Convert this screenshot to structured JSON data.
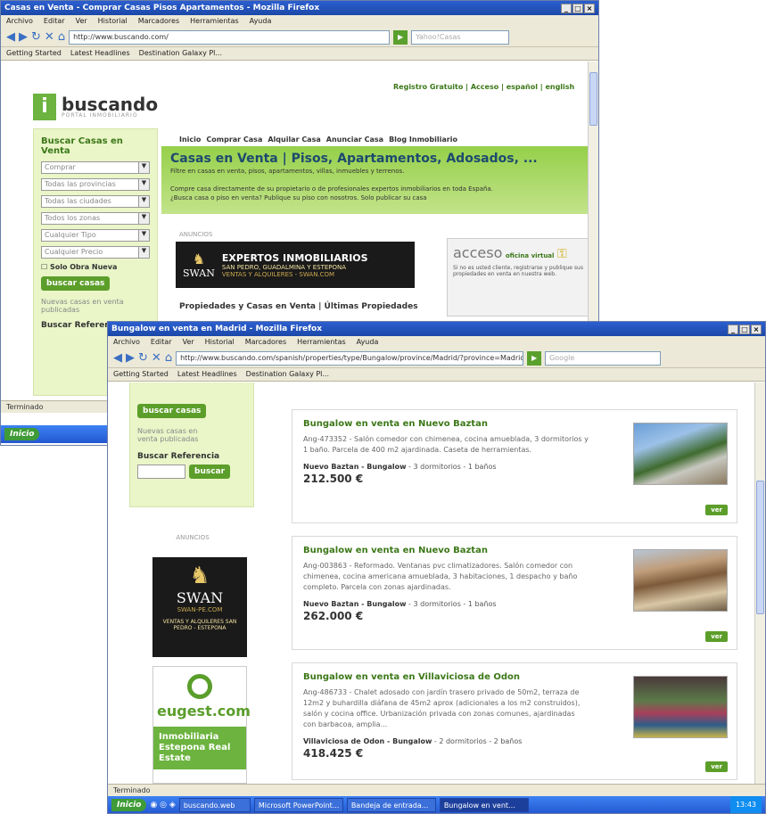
{
  "back_window": {
    "title": "Casas en Venta - Comprar Casas Pisos Apartamentos - Mozilla Firefox",
    "menu": [
      "Archivo",
      "Editar",
      "Ver",
      "Historial",
      "Marcadores",
      "Herramientas",
      "Ayuda"
    ],
    "url": "http://www.buscando.com/",
    "search_placeholder": "Yahoo!Casas",
    "bookmarks": [
      "Getting Started",
      "Latest Headlines",
      "Destination Galaxy Pl..."
    ],
    "site": {
      "logo_name": "buscando",
      "logo_tagline": "PORTAL INMOBILIARIO",
      "top_links": "Registro Gratuito | Acceso | español | english",
      "nav": [
        "Inicio",
        "Comprar Casa",
        "Alquilar Casa",
        "Anunciar Casa",
        "Blog Inmobiliario"
      ],
      "headline": "Casas en Venta | Pisos, Apartamentos, Adosados, ...",
      "headline_sub": "Filtre en casas en venta, pisos, apartamentos, villas, inmuebles y terrenos.",
      "headline_text": "Compre casa directamente de su propietario o de profesionales expertos inmobiliarios en toda España.",
      "headline_text2": "¿Busca casa o piso en venta? Publique su piso con nosotros. Solo publicar su casa",
      "sidebar_title": "Buscar Casas en Venta",
      "selects": [
        "Comprar",
        "Todas las provincias",
        "Todas las ciudades",
        "Todos los zonas",
        "Cualquier Tipo",
        "Cualquier Precio"
      ],
      "checkbox_label": "Solo Obra Nueva",
      "search_button": "buscar casas",
      "recent_link": "Nuevas casas en venta publicadas",
      "ref_label": "Buscar Referencia",
      "banner_label": "ANUNCIOS",
      "swan_banner_title": "EXPERTOS INMOBILIARIOS",
      "swan_banner_sub": "SAN PEDRO, GUADALMINA Y ESTEPONA",
      "swan_banner_sub2": "VENTAS Y ALQUILERES - SWAN.COM",
      "swan_name": "SWAN",
      "acceso_title": "acceso",
      "acceso_badge": "oficina virtual",
      "acceso_desc": "Si no es usted cliente, registrarse y publique sus propiedades en venta en nuestra web.",
      "section_title": "Propiedades y Casas en Venta | Últimas Propiedades"
    },
    "status": "Terminado",
    "taskbar_start": "Inicio"
  },
  "front_window": {
    "title": "Bungalow en venta en Madrid - Mozilla Firefox",
    "menu": [
      "Archivo",
      "Editar",
      "Ver",
      "Historial",
      "Marcadores",
      "Herramientas",
      "Ayuda"
    ],
    "url": "http://www.buscando.com/spanish/properties/type/Bungalow/province/Madrid/?province=Madrid&location",
    "search_placeholder": "Google",
    "bookmarks": [
      "Getting Started",
      "Latest Headlines",
      "Destination Galaxy Pl..."
    ],
    "sidebar": {
      "search_button": "buscar casas",
      "recent_link": "Nuevas casas en venta publicadas",
      "ref_label": "Buscar Referencia",
      "ref_button": "buscar",
      "ad_label": "ANUNCIOS",
      "swan_name": "SWAN",
      "swan_url": "SWAN-PE.COM",
      "swan_lines": "VENTAS Y ALQUILERES SAN PEDRO - ESTEPONA",
      "eugest_name": "eugest.com",
      "eugest_text": "Inmobiliaria Estepona Real Estate"
    },
    "listings": [
      {
        "title": "Bungalow en venta en Nuevo Baztan",
        "desc": "Ang-473352 - Salón comedor con chimenea, cocina amueblada, 3 dormitorios y 1 baño. Parcela de 400 m2 ajardinada. Caseta de herramientas.",
        "location": "Nuevo Baztan - Bungalow",
        "details": " - 3 dormitorios - 1 baños",
        "price": "212.500 €",
        "button": "ver"
      },
      {
        "title": "Bungalow en venta en Nuevo Baztan",
        "desc": "Ang-003863 - Reformado. Ventanas pvc climatizadores. Salón comedor con chimenea, cocina americana amueblada, 3 habitaciones, 1 despacho y baño completo. Parcela con zonas ajardinadas.",
        "location": "Nuevo Baztan - Bungalow",
        "details": " - 3 dormitorios - 1 baños",
        "price": "262.000 €",
        "button": "ver"
      },
      {
        "title": "Bungalow en venta en Villaviciosa de Odon",
        "desc": "Ang-486733 - Chalet adosado con jardín trasero privado de 50m2, terraza de 12m2 y buhardilla diáfana de 45m2 aprox (adicionales a los m2 construidos), salón y cocina office. Urbanización privada con zonas comunes, ajardinadas con barbacoa, amplia...",
        "location": "Villaviciosa de Odon - Bungalow",
        "details": " - 2 dormitorios - 2 baños",
        "price": "418.425 €",
        "button": "ver"
      }
    ],
    "status": "Terminado",
    "taskbar": {
      "start": "Inicio",
      "tasks": [
        "buscando.web",
        "Microsoft PowerPoint...",
        "Bandeja de entrada...",
        "Bungalow en vent..."
      ],
      "clock": "13:43"
    }
  }
}
